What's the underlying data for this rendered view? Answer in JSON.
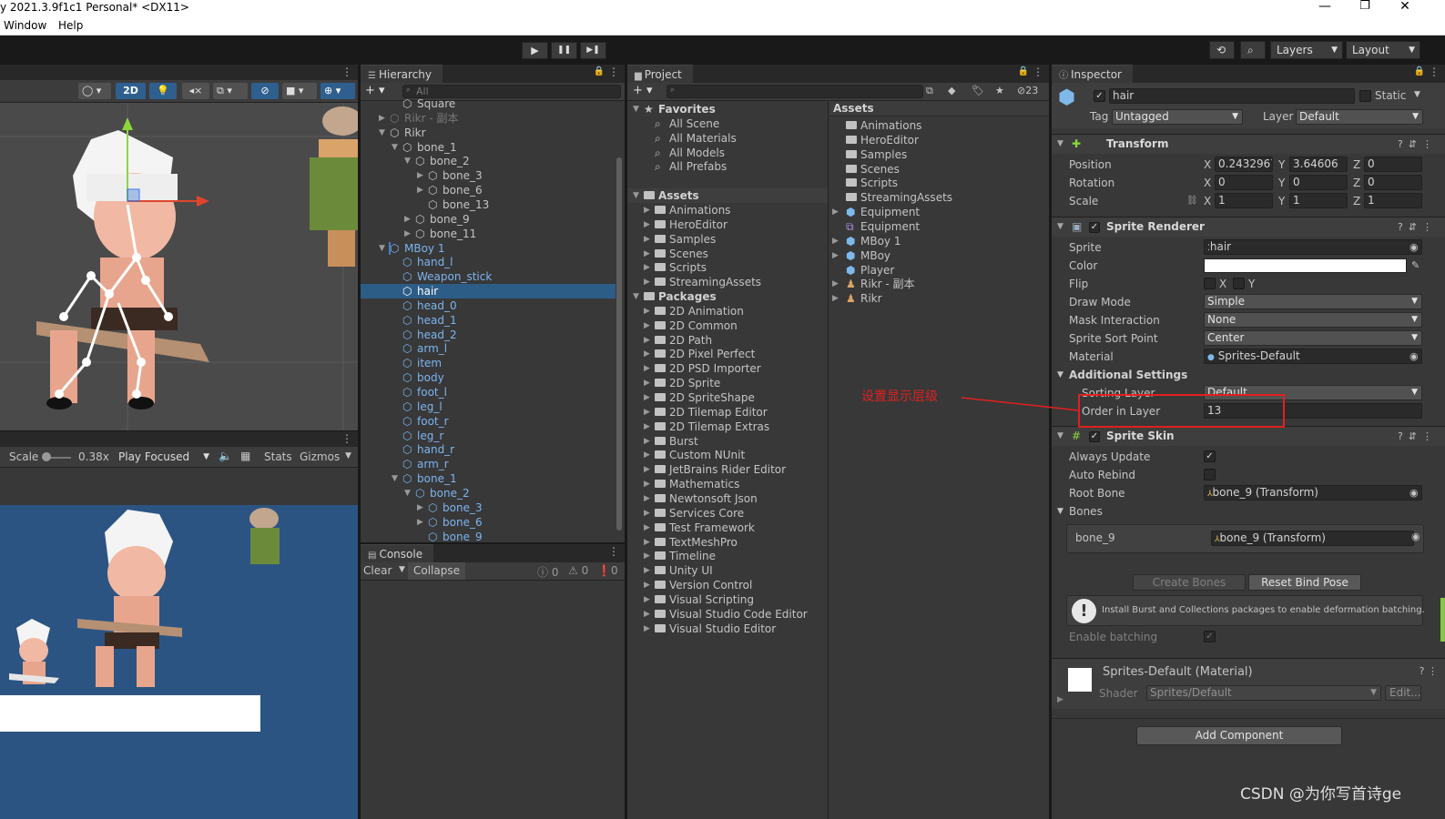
{
  "window": {
    "title": "y 2021.3.9f1c1 Personal* <DX11>",
    "menu": [
      "Window",
      "Help"
    ]
  },
  "toolbar": {
    "play": "▶",
    "pause": "❚❚",
    "step": "▶❚",
    "layers_label": "Layers",
    "layout_label": "Layout"
  },
  "scene": {
    "mode_2d": "2D",
    "game_bar": {
      "scale_label": "Scale",
      "scale_value": "0.38x",
      "play_mode": "Play Focused",
      "stats": "Stats",
      "gizmos": "Gizmos"
    }
  },
  "hierarchy": {
    "tab": "Hierarchy",
    "search_placeholder": "All",
    "items": [
      {
        "label": "Square",
        "depth": 2,
        "fold": "",
        "style": ""
      },
      {
        "label": "Rikr - 副本",
        "depth": 1,
        "fold": "▶",
        "style": "dim"
      },
      {
        "label": "Rikr",
        "depth": 1,
        "fold": "▼",
        "style": ""
      },
      {
        "label": "bone_1",
        "depth": 2,
        "fold": "▼",
        "style": ""
      },
      {
        "label": "bone_2",
        "depth": 3,
        "fold": "▼",
        "style": ""
      },
      {
        "label": "bone_3",
        "depth": 4,
        "fold": "▶",
        "style": ""
      },
      {
        "label": "bone_6",
        "depth": 4,
        "fold": "▶",
        "style": ""
      },
      {
        "label": "bone_13",
        "depth": 4,
        "fold": "",
        "style": ""
      },
      {
        "label": "bone_9",
        "depth": 3,
        "fold": "▶",
        "style": ""
      },
      {
        "label": "bone_11",
        "depth": 3,
        "fold": "▶",
        "style": ""
      },
      {
        "label": "MBoy 1",
        "depth": 1,
        "fold": "▼",
        "style": "blue"
      },
      {
        "label": "hand_l",
        "depth": 2,
        "fold": "",
        "style": "blue"
      },
      {
        "label": "Weapon_stick",
        "depth": 2,
        "fold": "",
        "style": "blue"
      },
      {
        "label": "hair",
        "depth": 2,
        "fold": "",
        "style": "sel"
      },
      {
        "label": "head_0",
        "depth": 2,
        "fold": "",
        "style": "blue"
      },
      {
        "label": "head_1",
        "depth": 2,
        "fold": "",
        "style": "blue"
      },
      {
        "label": "head_2",
        "depth": 2,
        "fold": "",
        "style": "blue"
      },
      {
        "label": "arm_l",
        "depth": 2,
        "fold": "",
        "style": "blue"
      },
      {
        "label": "item",
        "depth": 2,
        "fold": "",
        "style": "blue"
      },
      {
        "label": "body",
        "depth": 2,
        "fold": "",
        "style": "blue"
      },
      {
        "label": "foot_l",
        "depth": 2,
        "fold": "",
        "style": "blue"
      },
      {
        "label": "leg_l",
        "depth": 2,
        "fold": "",
        "style": "blue"
      },
      {
        "label": "foot_r",
        "depth": 2,
        "fold": "",
        "style": "blue"
      },
      {
        "label": "leg_r",
        "depth": 2,
        "fold": "",
        "style": "blue"
      },
      {
        "label": "hand_r",
        "depth": 2,
        "fold": "",
        "style": "blue"
      },
      {
        "label": "arm_r",
        "depth": 2,
        "fold": "",
        "style": "blue"
      },
      {
        "label": "bone_1",
        "depth": 2,
        "fold": "▼",
        "style": "blue"
      },
      {
        "label": "bone_2",
        "depth": 3,
        "fold": "▼",
        "style": "blue"
      },
      {
        "label": "bone_3",
        "depth": 4,
        "fold": "▶",
        "style": "blue"
      },
      {
        "label": "bone_6",
        "depth": 4,
        "fold": "▶",
        "style": "blue"
      },
      {
        "label": "bone_9",
        "depth": 4,
        "fold": "",
        "style": "blue"
      }
    ]
  },
  "console": {
    "tab": "Console",
    "clear": "Clear",
    "collapse": "Collapse",
    "counts": [
      "0",
      "0",
      "0"
    ]
  },
  "project": {
    "tab": "Project",
    "hidden_count": "23",
    "favorites_label": "Favorites",
    "favorites": [
      "All Scene",
      "All Materials",
      "All Models",
      "All Prefabs"
    ],
    "assets_label": "Assets",
    "assets_tree": [
      "Animations",
      "HeroEditor",
      "Samples",
      "Scenes",
      "Scripts",
      "StreamingAssets"
    ],
    "packages_label": "Packages",
    "packages": [
      "2D Animation",
      "2D Common",
      "2D Path",
      "2D Pixel Perfect",
      "2D PSD Importer",
      "2D Sprite",
      "2D SpriteShape",
      "2D Tilemap Editor",
      "2D Tilemap Extras",
      "Burst",
      "Custom NUnit",
      "JetBrains Rider Editor",
      "Mathematics",
      "Newtonsoft Json",
      "Services Core",
      "Test Framework",
      "TextMeshPro",
      "Timeline",
      "Unity UI",
      "Version Control",
      "Visual Scripting",
      "Visual Studio Code Editor",
      "Visual Studio Editor"
    ],
    "content_header": "Assets",
    "content": [
      {
        "label": "Animations",
        "kind": "folder",
        "fold": ""
      },
      {
        "label": "HeroEditor",
        "kind": "folder",
        "fold": ""
      },
      {
        "label": "Samples",
        "kind": "folder",
        "fold": ""
      },
      {
        "label": "Scenes",
        "kind": "folder",
        "fold": ""
      },
      {
        "label": "Scripts",
        "kind": "folder",
        "fold": ""
      },
      {
        "label": "StreamingAssets",
        "kind": "folder",
        "fold": ""
      },
      {
        "label": "Equipment",
        "kind": "prefab",
        "fold": "▶"
      },
      {
        "label": "Equipment",
        "kind": "script",
        "fold": ""
      },
      {
        "label": "MBoy 1",
        "kind": "prefab",
        "fold": "▶"
      },
      {
        "label": "MBoy",
        "kind": "prefab",
        "fold": "▶"
      },
      {
        "label": "Player",
        "kind": "prefab",
        "fold": ""
      },
      {
        "label": "Rikr - 副本",
        "kind": "sprite",
        "fold": "▶"
      },
      {
        "label": "Rikr",
        "kind": "sprite",
        "fold": "▶"
      }
    ]
  },
  "inspector": {
    "tab": "Inspector",
    "object_name": "hair",
    "static_label": "Static",
    "tag_label": "Tag",
    "tag_value": "Untagged",
    "layer_label": "Layer",
    "layer_value": "Default",
    "transform": {
      "title": "Transform",
      "rows": [
        {
          "label": "Position",
          "x": "0.2432967",
          "y": "3.64606",
          "z": "0"
        },
        {
          "label": "Rotation",
          "x": "0",
          "y": "0",
          "z": "0"
        },
        {
          "label": "Scale",
          "x": "1",
          "y": "1",
          "z": "1"
        }
      ]
    },
    "sprite_renderer": {
      "title": "Sprite Renderer",
      "sprite_label": "Sprite",
      "sprite_value": "hair",
      "color_label": "Color",
      "color_value": "#ffffff",
      "flip_label": "Flip",
      "flip_x": "X",
      "flip_y": "Y",
      "draw_mode_label": "Draw Mode",
      "draw_mode_value": "Simple",
      "mask_label": "Mask Interaction",
      "mask_value": "None",
      "sort_point_label": "Sprite Sort Point",
      "sort_point_value": "Center",
      "material_label": "Material",
      "material_value": "Sprites-Default",
      "additional_label": "Additional Settings",
      "sorting_layer_label": "Sorting Layer",
      "sorting_layer_value": "Default",
      "order_label": "Order in Layer",
      "order_value": "13"
    },
    "sprite_skin": {
      "title": "Sprite Skin",
      "always_update_label": "Always Update",
      "auto_rebind_label": "Auto Rebind",
      "root_bone_label": "Root Bone",
      "root_bone_value": "bone_9 (Transform)",
      "bones_label": "Bones",
      "bone_name": "bone_9",
      "bone_value": "bone_9 (Transform)",
      "create_bones": "Create Bones",
      "reset_bind_pose": "Reset Bind Pose",
      "warning": "Install Burst and Collections packages to enable deformation batching.",
      "batching_label": "Enable batching"
    },
    "material": {
      "title": "Sprites-Default (Material)",
      "shader_label": "Shader",
      "shader_value": "Sprites/Default",
      "edit": "Edit..."
    },
    "add_component": "Add Component"
  },
  "annotation": {
    "text": "设置显示层级",
    "color": "#e02020"
  },
  "watermark": "CSDN @为你写首诗ge"
}
